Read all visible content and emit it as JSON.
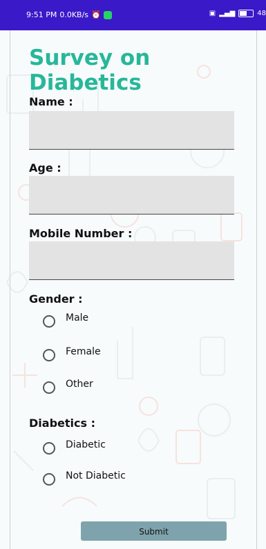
{
  "status_bar": {
    "time": "9:51 PM",
    "network_speed": "0.0KB/s",
    "battery": "48"
  },
  "page": {
    "title": "Survey on Diabetics"
  },
  "form": {
    "name_label": "Name :",
    "name_value": "",
    "age_label": "Age :",
    "age_value": "",
    "mobile_label": "Mobile Number :",
    "mobile_value": "",
    "gender_label": "Gender :",
    "gender_options": [
      "Male",
      "Female",
      "Other"
    ],
    "diabetics_label": "Diabetics :",
    "diabetics_options": [
      "Diabetic",
      "Not Diabetic"
    ],
    "submit_label": "Submit"
  },
  "colors": {
    "status_bar": "#3a19c9",
    "title": "#27b79a",
    "field_bg": "#e3e3e3",
    "submit_bg": "#7fa3ac"
  }
}
